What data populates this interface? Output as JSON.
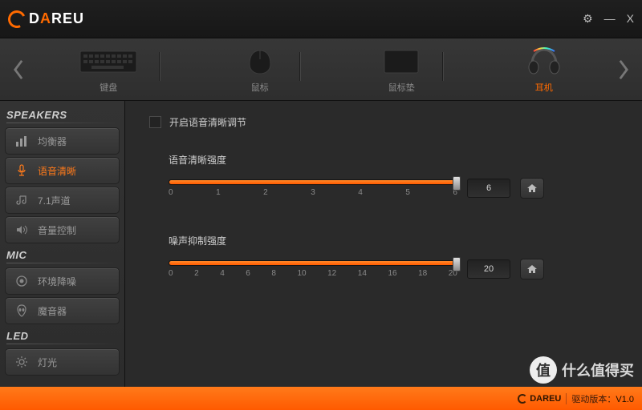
{
  "brand": {
    "name_html_pre": "D",
    "name_html_accent": "A",
    "name_html_post": "REU"
  },
  "window": {
    "settings": "⚙",
    "min": "—",
    "close": "X"
  },
  "tabs": [
    {
      "label": "键盘",
      "active": false
    },
    {
      "label": "鼠标",
      "active": false
    },
    {
      "label": "鼠标垫",
      "active": false
    },
    {
      "label": "耳机",
      "active": true
    }
  ],
  "sidebar": {
    "sections": [
      {
        "title": "SPEAKERS",
        "items": [
          {
            "label": "均衡器",
            "icon": "bars",
            "active": false
          },
          {
            "label": "语音清晰",
            "icon": "mic",
            "active": true
          },
          {
            "label": "7.1声道",
            "icon": "note",
            "active": false
          },
          {
            "label": "音量控制",
            "icon": "vol",
            "active": false
          }
        ]
      },
      {
        "title": "MIC",
        "items": [
          {
            "label": "环境降噪",
            "icon": "target",
            "active": false
          },
          {
            "label": "魔音器",
            "icon": "alien",
            "active": false
          }
        ]
      },
      {
        "title": "LED",
        "items": [
          {
            "label": "灯光",
            "icon": "light",
            "active": false
          }
        ]
      }
    ]
  },
  "content": {
    "checkbox_label": "开启语音清晰调节",
    "sliders": [
      {
        "label": "语音清晰强度",
        "value": "6",
        "max": 6,
        "ticks": [
          "0",
          "1",
          "2",
          "3",
          "4",
          "5",
          "6"
        ],
        "fill_pct": 100
      },
      {
        "label": "噪声抑制强度",
        "value": "20",
        "max": 20,
        "ticks": [
          "0",
          "2",
          "4",
          "6",
          "8",
          "10",
          "12",
          "14",
          "16",
          "18",
          "20"
        ],
        "fill_pct": 100
      }
    ]
  },
  "footer": {
    "brand": "DAREU",
    "version_label": "驱动版本：",
    "version": "V1.0"
  },
  "watermark": {
    "badge": "值",
    "text": "什么值得买"
  },
  "colors": {
    "accent": "#ff6a00"
  }
}
